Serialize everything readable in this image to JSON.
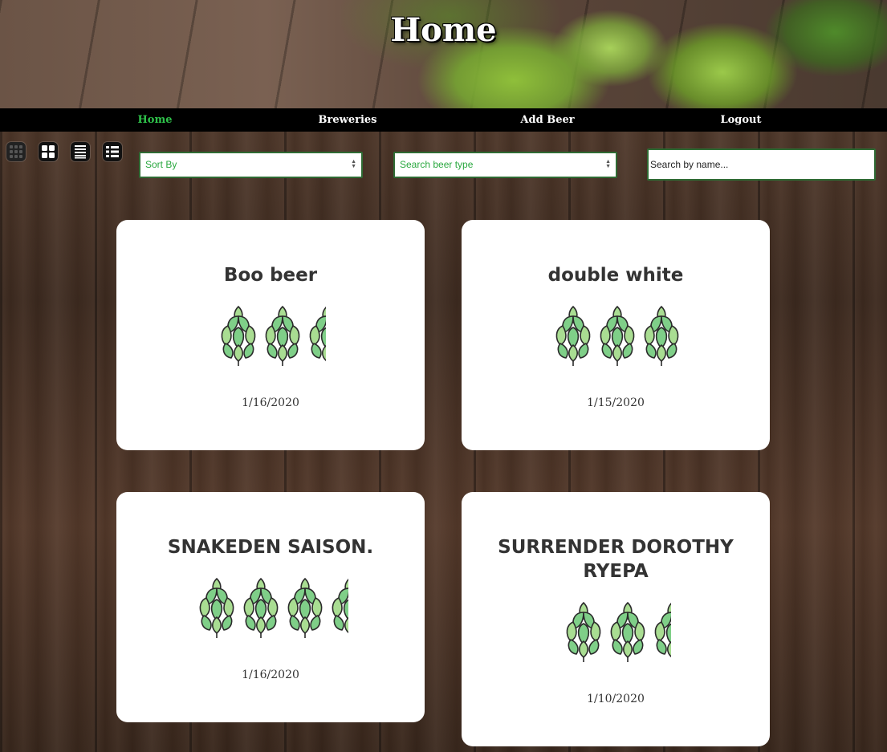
{
  "header": {
    "title": "Home"
  },
  "nav": {
    "items": [
      {
        "label": "Home",
        "active": true
      },
      {
        "label": "Breweries",
        "active": false
      },
      {
        "label": "Add Beer",
        "active": false
      },
      {
        "label": "Logout",
        "active": false
      }
    ]
  },
  "toolbar": {
    "view_icons": [
      "grid-3x3-icon",
      "grid-2x2-icon",
      "list-lines-icon",
      "list-detail-icon"
    ],
    "sort_select": {
      "value": "Sort By"
    },
    "type_select": {
      "value": "Search beer type"
    },
    "search": {
      "placeholder": "Search by name..."
    }
  },
  "cards": [
    {
      "name": "Boo beer",
      "rating": 2.5,
      "date": "1/16/2020"
    },
    {
      "name": "double white",
      "rating": 3,
      "date": "1/15/2020"
    },
    {
      "name": "SNAKEDEN SAISON.",
      "rating": 3.5,
      "date": "1/16/2020"
    },
    {
      "name": "SURRENDER DOROTHY RYEPA",
      "rating": 2.5,
      "date": "1/10/2020"
    }
  ],
  "colors": {
    "accent": "#2ec24a",
    "nav_bg": "#000000",
    "border": "#2f6b34"
  }
}
